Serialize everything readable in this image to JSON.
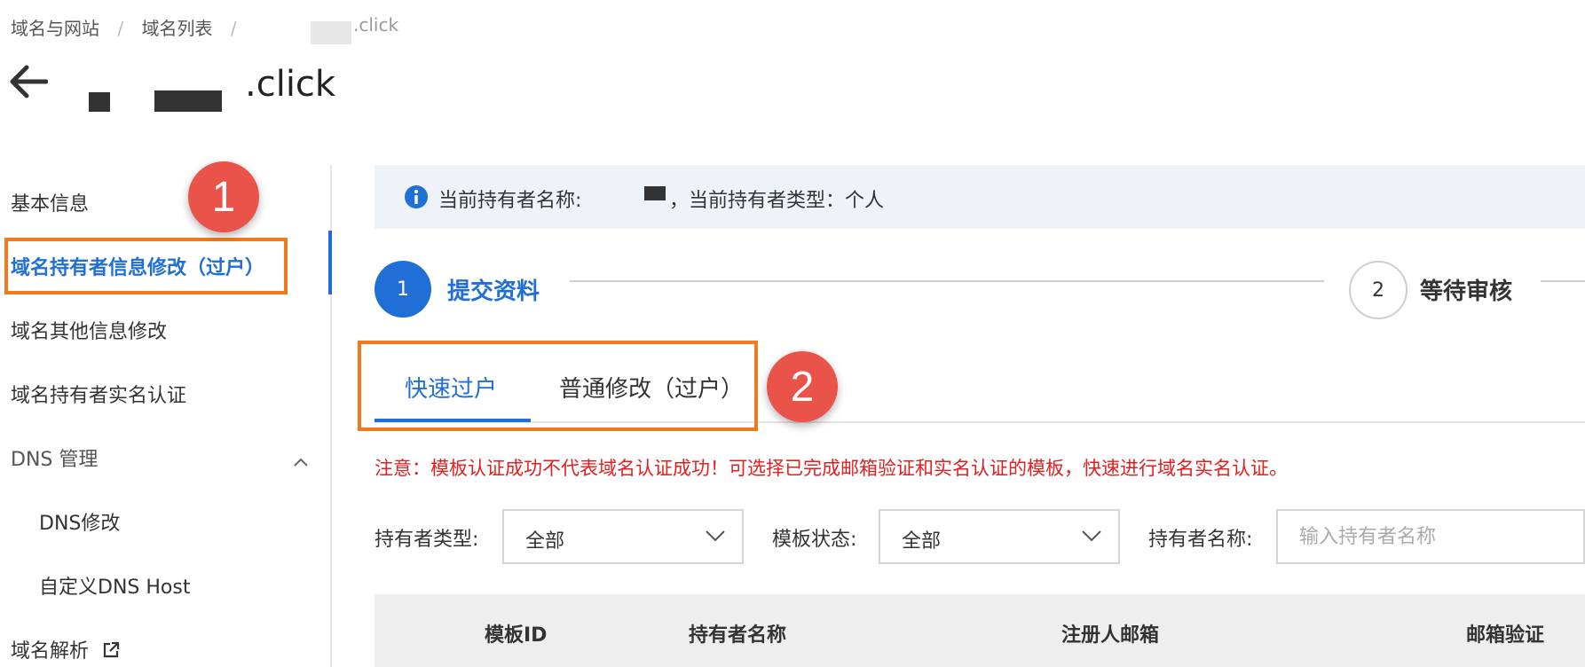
{
  "breadcrumb": {
    "items": [
      "域名与网站",
      "域名列表",
      ".click"
    ],
    "separator": "/"
  },
  "header": {
    "title_suffix": ".click"
  },
  "sidebar": {
    "items": [
      {
        "label": "基本信息"
      },
      {
        "label": "域名持有者信息修改（过户）"
      },
      {
        "label": "域名其他信息修改"
      },
      {
        "label": "域名持有者实名认证"
      },
      {
        "label": "DNS 管理"
      },
      {
        "label": "DNS修改"
      },
      {
        "label": "自定义DNS Host"
      },
      {
        "label": "域名解析"
      }
    ]
  },
  "annotations": {
    "badge1": "1",
    "badge2": "2"
  },
  "info_bar": {
    "holder_name_label": "当前持有者名称:",
    "holder_type_text": "，当前持有者类型：个人"
  },
  "steps": [
    {
      "number": "1",
      "label": "提交资料"
    },
    {
      "number": "2",
      "label": "等待审核"
    }
  ],
  "tabs": [
    {
      "label": "快速过户"
    },
    {
      "label": "普通修改（过户）"
    }
  ],
  "notice": "注意：模板认证成功不代表域名认证成功！可选择已完成邮箱验证和实名认证的模板，快速进行域名实名认证。",
  "filters": {
    "holder_type_label": "持有者类型:",
    "holder_type_value": "全部",
    "template_status_label": "模板状态:",
    "template_status_value": "全部",
    "holder_name_label": "持有者名称:",
    "holder_name_placeholder": "输入持有者名称"
  },
  "table": {
    "columns": [
      "模板ID",
      "持有者名称",
      "注册人邮箱",
      "邮箱验证"
    ]
  },
  "colors": {
    "primary": "#1f6fd6",
    "highlight_box": "#f07a1d",
    "badge": "#e9534a",
    "notice": "#e02020",
    "info_bar_bg": "#eef2f9"
  }
}
